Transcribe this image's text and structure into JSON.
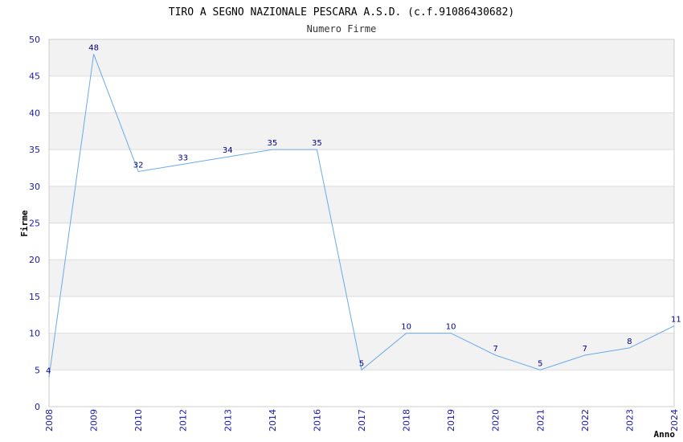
{
  "chart_data": {
    "type": "line",
    "title": "TIRO A SEGNO NAZIONALE PESCARA A.S.D. (c.f.91086430682)",
    "subtitle": "Numero Firme",
    "xlabel": "Anno",
    "ylabel": "Firme",
    "categories": [
      "2008",
      "2009",
      "2010",
      "2012",
      "2013",
      "2014",
      "2016",
      "2017",
      "2018",
      "2019",
      "2020",
      "2021",
      "2022",
      "2023",
      "2024"
    ],
    "values": [
      4,
      48,
      32,
      33,
      34,
      35,
      35,
      5,
      10,
      10,
      7,
      5,
      7,
      8,
      11
    ],
    "ylim": [
      0,
      50
    ],
    "yticks": [
      "0",
      "5",
      "10",
      "15",
      "20",
      "25",
      "30",
      "35",
      "40",
      "45",
      "50"
    ],
    "grid": true,
    "colors": {
      "line": "#6aaae8",
      "band": "#f2f2f2",
      "grid": "#dddddd",
      "tick": "#1a1aa6",
      "label": "#000080"
    }
  }
}
